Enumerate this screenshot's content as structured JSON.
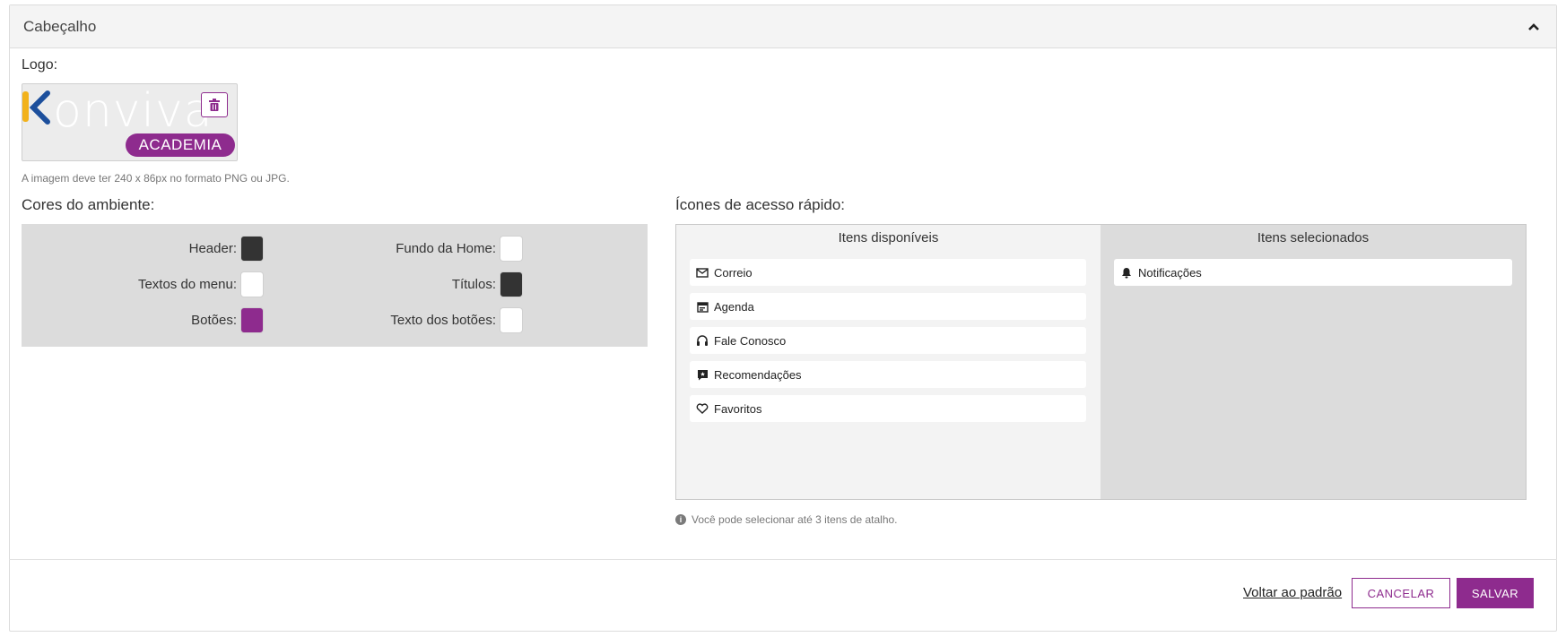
{
  "panel": {
    "title": "Cabeçalho"
  },
  "logo": {
    "label": "Logo:",
    "brand_word": "onviva",
    "brand_badge": "ACADEMIA",
    "hint": "A imagem deve ter 240 x 86px no formato PNG ou JPG."
  },
  "colors": {
    "title": "Cores do ambiente:",
    "items": [
      {
        "label": "Header:",
        "color": "#333333"
      },
      {
        "label": "Fundo da Home:",
        "color": "#ffffff"
      },
      {
        "label": "Textos do menu:",
        "color": "#ffffff"
      },
      {
        "label": "Títulos:",
        "color": "#333333"
      },
      {
        "label": "Botões:",
        "color": "#8e2b8e"
      },
      {
        "label": "Texto dos botões:",
        "color": "#ffffff"
      }
    ]
  },
  "quick_access": {
    "title": "Ícones de acesso rápido:",
    "available_title": "Itens disponíveis",
    "selected_title": "Itens selecionados",
    "available": [
      {
        "label": "Correio",
        "icon": "mail-icon"
      },
      {
        "label": "Agenda",
        "icon": "calendar-icon"
      },
      {
        "label": "Fale Conosco",
        "icon": "headset-icon"
      },
      {
        "label": "Recomendações",
        "icon": "recommend-icon"
      },
      {
        "label": "Favoritos",
        "icon": "heart-icon"
      }
    ],
    "selected": [
      {
        "label": "Notificações",
        "icon": "bell-icon"
      }
    ],
    "hint": "Você pode selecionar até 3 itens de atalho."
  },
  "footer": {
    "reset_label": "Voltar ao padrão",
    "cancel_label": "CANCELAR",
    "save_label": "SALVAR"
  },
  "accent_color": "#8e2b8e"
}
